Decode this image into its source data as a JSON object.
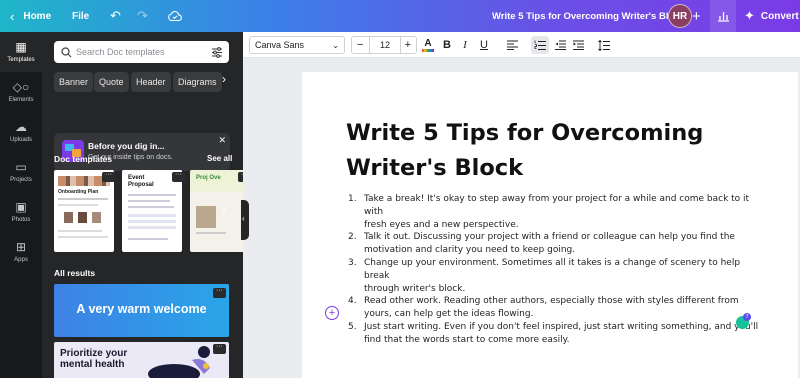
{
  "topbar": {
    "home_label": "Home",
    "file_label": "File",
    "doc_title": "Write 5 Tips for Overcoming Writer's Block",
    "avatar_initials": "HR",
    "convert_label": "Convert"
  },
  "rail": {
    "items": [
      {
        "label": "Templates",
        "icon": "templates-icon"
      },
      {
        "label": "Elements",
        "icon": "elements-icon"
      },
      {
        "label": "Uploads",
        "icon": "uploads-icon"
      },
      {
        "label": "Projects",
        "icon": "projects-icon"
      },
      {
        "label": "Photos",
        "icon": "photos-icon"
      },
      {
        "label": "Apps",
        "icon": "apps-icon"
      }
    ]
  },
  "panel": {
    "search_placeholder": "Search Doc templates",
    "chips": [
      "Banner",
      "Quote",
      "Header",
      "Diagrams"
    ],
    "promo_title": "Before you dig in...",
    "promo_sub": "Get our inside tips on docs.",
    "doc_templates_title": "Doc templates",
    "see_all": "See all",
    "templates": [
      "Onboarding Plan",
      "Event Proposal",
      "Proj Ove"
    ],
    "all_results_title": "All results",
    "result_1": "A very warm welcome",
    "result_2_line1": "Prioritize your",
    "result_2_line2": "mental health"
  },
  "toolbar": {
    "font": "Canva Sans",
    "font_size": "12"
  },
  "doc": {
    "title_line1": "Write 5 Tips for Overcoming",
    "title_line2": "Writer's Block",
    "items": [
      {
        "n": "1.",
        "l1": "Take a break! It's okay to step away from your project for a while and come back to it with",
        "l2": "fresh eyes and a new perspective."
      },
      {
        "n": "2.",
        "l1": "Talk it out. Discussing your project with a friend or colleague can help you find the",
        "l2": "motivation and clarity you need to keep going."
      },
      {
        "n": "3.",
        "l1": "Change up your environment. Sometimes all it takes is a change of scenery to help break",
        "l2": "through writer's block."
      },
      {
        "n": "4.",
        "l1": "Read other work. Reading other authors, especially those with styles different from",
        "l2": "yours, can help get the ideas flowing."
      },
      {
        "n": "5.",
        "l1": "Just start writing. Even if you don't feel inspired, just start writing something, and you'll",
        "l2": "find that the words start to come more easily."
      }
    ],
    "grammar_badge": "7"
  },
  "colors": {
    "accent": "#7c3ae6",
    "rail_bg": "#18191b",
    "panel_bg": "#252627"
  }
}
